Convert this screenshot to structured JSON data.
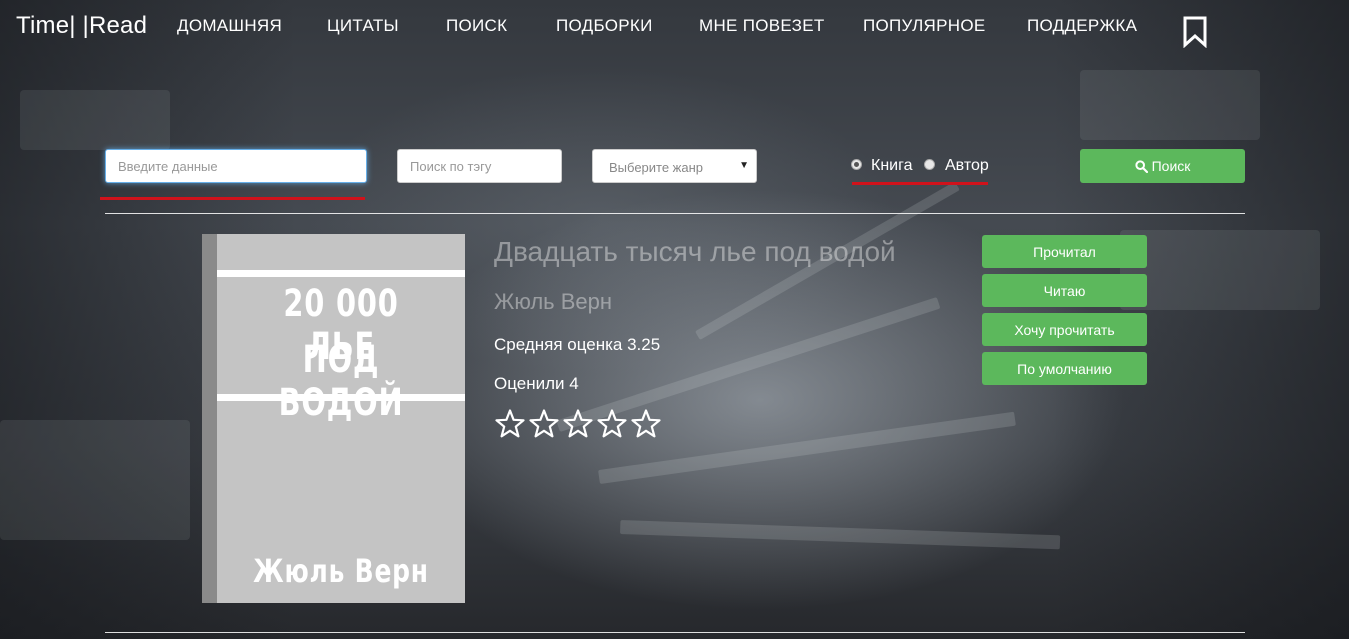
{
  "brand": {
    "logo": "Time| |Read"
  },
  "nav": {
    "items": [
      {
        "label": "ДОМАШНЯЯ"
      },
      {
        "label": "ЦИТАТЫ"
      },
      {
        "label": "ПОИСК"
      },
      {
        "label": "ПОДБОРКИ"
      },
      {
        "label": "МНЕ ПОВЕЗЕТ"
      },
      {
        "label": "ПОПУЛЯРНОЕ"
      },
      {
        "label": "ПОДДЕРЖКА"
      }
    ],
    "bookmark_icon": "bookmark-icon"
  },
  "search": {
    "query_placeholder": "Введите данные",
    "query_value": "",
    "tag_placeholder": "Поиск по тэгу",
    "genre_selected": "Выберите жанр",
    "radio_book": "Книга",
    "radio_author": "Автор",
    "radio_selected": "Книга",
    "button_label": "Поиск",
    "button_icon": "search-icon"
  },
  "book": {
    "cover": {
      "title_line1": "20 000 ЛЬЕ",
      "title_line2": "ПОД ВОДОЙ",
      "author": "Жюль Верн"
    },
    "title": "Двадцать тысяч лье под водой",
    "author": "Жюль Верн",
    "avg_rating_text": "Средняя оценка 3.25",
    "rated_count_text": "Оценили 4",
    "user_stars_filled": 0,
    "stars_total": 5
  },
  "actions": {
    "read": "Прочитал",
    "reading": "Читаю",
    "want_to_read": "Хочу прочитать",
    "default": "По умолчанию"
  },
  "colors": {
    "accent_green": "#5cb85c",
    "underline_red": "#d0121b"
  }
}
